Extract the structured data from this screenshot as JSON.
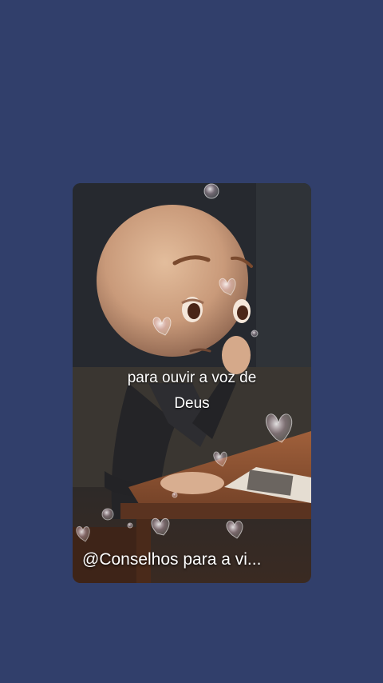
{
  "background_color": "#313f6b",
  "video": {
    "caption_line1": "para ouvir a voz de",
    "caption_line2": "Deus",
    "watermark": "@Conselhos para a vi...",
    "illustration": "sad-bald-figure-at-table-icon"
  }
}
